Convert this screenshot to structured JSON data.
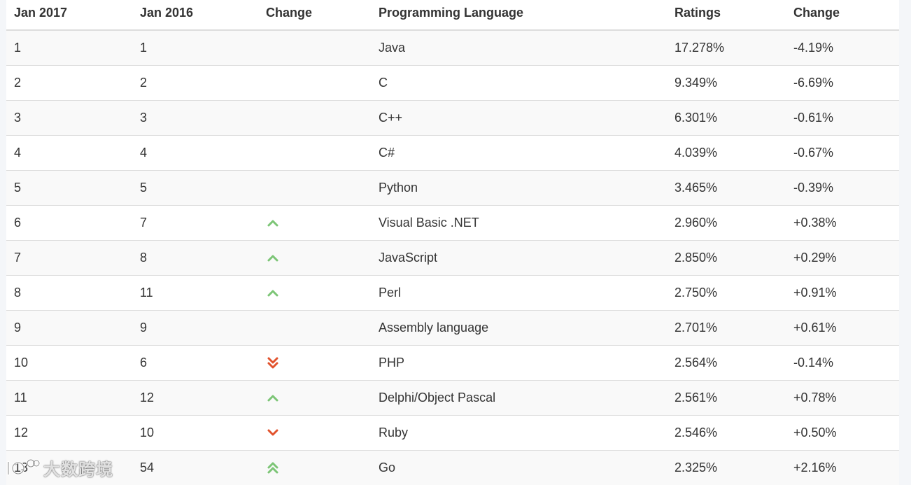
{
  "table": {
    "headers": [
      "Jan 2017",
      "Jan 2016",
      "Change",
      "Programming Language",
      "Ratings",
      "Change"
    ],
    "rows": [
      {
        "rank2017": "1",
        "rank2016": "1",
        "trend": "none",
        "language": "Java",
        "rating": "17.278%",
        "change": "-4.19%"
      },
      {
        "rank2017": "2",
        "rank2016": "2",
        "trend": "none",
        "language": "C",
        "rating": "9.349%",
        "change": "-6.69%"
      },
      {
        "rank2017": "3",
        "rank2016": "3",
        "trend": "none",
        "language": "C++",
        "rating": "6.301%",
        "change": "-0.61%"
      },
      {
        "rank2017": "4",
        "rank2016": "4",
        "trend": "none",
        "language": "C#",
        "rating": "4.039%",
        "change": "-0.67%"
      },
      {
        "rank2017": "5",
        "rank2016": "5",
        "trend": "none",
        "language": "Python",
        "rating": "3.465%",
        "change": "-0.39%"
      },
      {
        "rank2017": "6",
        "rank2016": "7",
        "trend": "up",
        "language": "Visual Basic .NET",
        "rating": "2.960%",
        "change": "+0.38%"
      },
      {
        "rank2017": "7",
        "rank2016": "8",
        "trend": "up",
        "language": "JavaScript",
        "rating": "2.850%",
        "change": "+0.29%"
      },
      {
        "rank2017": "8",
        "rank2016": "11",
        "trend": "up",
        "language": "Perl",
        "rating": "2.750%",
        "change": "+0.91%"
      },
      {
        "rank2017": "9",
        "rank2016": "9",
        "trend": "none",
        "language": "Assembly language",
        "rating": "2.701%",
        "change": "+0.61%"
      },
      {
        "rank2017": "10",
        "rank2016": "6",
        "trend": "double-down",
        "language": "PHP",
        "rating": "2.564%",
        "change": "-0.14%"
      },
      {
        "rank2017": "11",
        "rank2016": "12",
        "trend": "up",
        "language": "Delphi/Object Pascal",
        "rating": "2.561%",
        "change": "+0.78%"
      },
      {
        "rank2017": "12",
        "rank2016": "10",
        "trend": "down",
        "language": "Ruby",
        "rating": "2.546%",
        "change": "+0.50%"
      },
      {
        "rank2017": "13",
        "rank2016": "54",
        "trend": "double-up",
        "language": "Go",
        "rating": "2.325%",
        "change": "+2.16%"
      }
    ]
  },
  "icons": {
    "up": "chevron-up-icon",
    "down": "chevron-down-icon",
    "double-up": "double-chevron-up-icon",
    "double-down": "double-chevron-down-icon"
  },
  "colors": {
    "up": "#7cc576",
    "down": "#e2532d",
    "border": "#dddddd",
    "stripe": "#f9f9f9"
  },
  "watermark": {
    "text": "大数跨境"
  }
}
